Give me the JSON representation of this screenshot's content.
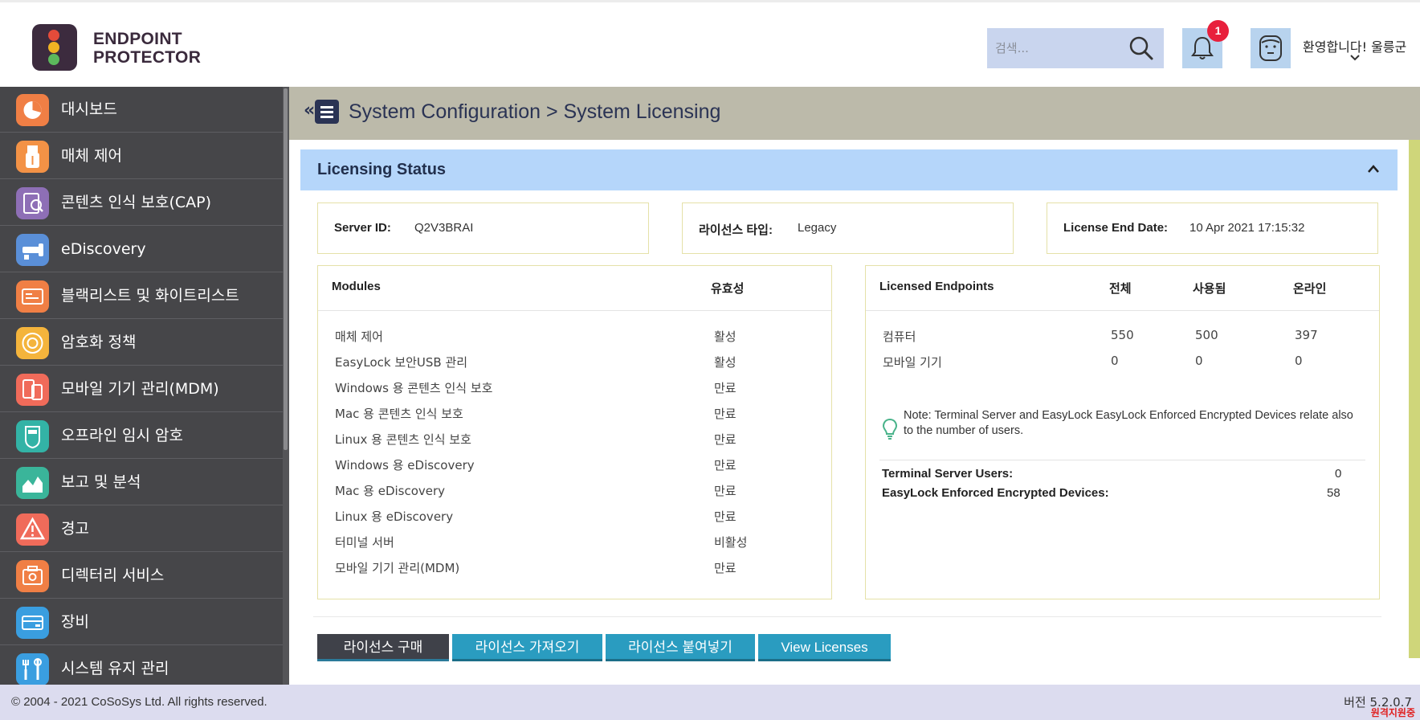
{
  "header": {
    "brand_line1": "ENDPOINT",
    "brand_line2": "PROTECTOR",
    "search_placeholder": "검색...",
    "notification_count": "1",
    "welcome": "환영합니다! 울릉군"
  },
  "sidebar": {
    "items": [
      {
        "label": "대시보드",
        "icon": "dashboard-icon",
        "color": "#f07f45"
      },
      {
        "label": "매체 제어",
        "icon": "usb-icon",
        "color": "#f39246"
      },
      {
        "label": "콘텐츠 인식 보호(CAP)",
        "icon": "content-aware-icon",
        "color": "#8e6fb6"
      },
      {
        "label": "eDiscovery",
        "icon": "ediscovery-icon",
        "color": "#5a8fd8"
      },
      {
        "label": "블랙리스트 및 화이트리스트",
        "icon": "blacklist-icon",
        "color": "#f07f45"
      },
      {
        "label": "암호화 정책",
        "icon": "encryption-icon",
        "color": "#f4b43c"
      },
      {
        "label": "모바일 기기 관리(MDM)",
        "icon": "mobile-icon",
        "color": "#f06b5a"
      },
      {
        "label": "오프라인 임시 암호",
        "icon": "offline-password-icon",
        "color": "#33b3a6"
      },
      {
        "label": "보고 및 분석",
        "icon": "reports-icon",
        "color": "#3ab59a"
      },
      {
        "label": "경고",
        "icon": "alert-icon",
        "color": "#f06b5a"
      },
      {
        "label": "디렉터리 서비스",
        "icon": "directory-icon",
        "color": "#f07f45"
      },
      {
        "label": "장비",
        "icon": "appliance-icon",
        "color": "#3a9ee0"
      },
      {
        "label": "시스템 유지 관리",
        "icon": "maintenance-icon",
        "color": "#3a9ee0"
      }
    ]
  },
  "breadcrumb": {
    "collapse": "«",
    "text": "System Configuration > System Licensing"
  },
  "licensing": {
    "title": "Licensing Status",
    "server_id_label": "Server ID:",
    "server_id_value": "Q2V3BRAI",
    "license_type_label": "라이선스 타입:",
    "license_type_value": "Legacy",
    "end_date_label": "License End Date:",
    "end_date_value": "10 Apr 2021 17:15:32"
  },
  "modules": {
    "header_name": "Modules",
    "header_status": "유효성",
    "rows": [
      {
        "name": "매체 제어",
        "status": "활성"
      },
      {
        "name": "EasyLock 보안USB 관리",
        "status": "활성"
      },
      {
        "name": "Windows 용 콘텐츠 인식 보호",
        "status": "만료"
      },
      {
        "name": "Mac 용 콘텐츠 인식 보호",
        "status": "만료"
      },
      {
        "name": "Linux 용 콘텐츠 인식 보호",
        "status": "만료"
      },
      {
        "name": "Windows 용 eDiscovery",
        "status": "만료"
      },
      {
        "name": "Mac 용 eDiscovery",
        "status": "만료"
      },
      {
        "name": "Linux 용 eDiscovery",
        "status": "만료"
      },
      {
        "name": "터미널 서버",
        "status": "비활성"
      },
      {
        "name": "모바일 기기 관리(MDM)",
        "status": "만료"
      }
    ]
  },
  "endpoints": {
    "header_name": "Licensed Endpoints",
    "header_total": "전체",
    "header_used": "사용됨",
    "header_online": "온라인",
    "rows": [
      {
        "name": "컴퓨터",
        "total": "550",
        "used": "500",
        "online": "397"
      },
      {
        "name": "모바일 기기",
        "total": "0",
        "used": "0",
        "online": "0"
      }
    ],
    "note": "Note: Terminal Server and EasyLock EasyLock Enforced Encrypted Devices relate also to the number of users.",
    "terminal_label": "Terminal Server Users:",
    "terminal_value": "0",
    "easylock_label": "EasyLock Enforced Encrypted Devices:",
    "easylock_value": "58"
  },
  "buttons": {
    "buy": "라이선스 구매",
    "import": "라이선스 가져오기",
    "paste": "라이선스 붙여넣기",
    "view": "View Licenses"
  },
  "footer": {
    "copyright": "© 2004 - 2021 CoSoSys Ltd. All rights reserved.",
    "version": "버전 5.2.0.7",
    "remote_support": "원격지원중"
  },
  "colors": {
    "sidebar_bg": "#464649",
    "breadcrumb_bg": "#bcbaaa",
    "panel_header_bg": "#b5d6fa",
    "button_teal": "#2a9cc0",
    "button_dark": "#3f4149",
    "badge": "#e8203c"
  }
}
